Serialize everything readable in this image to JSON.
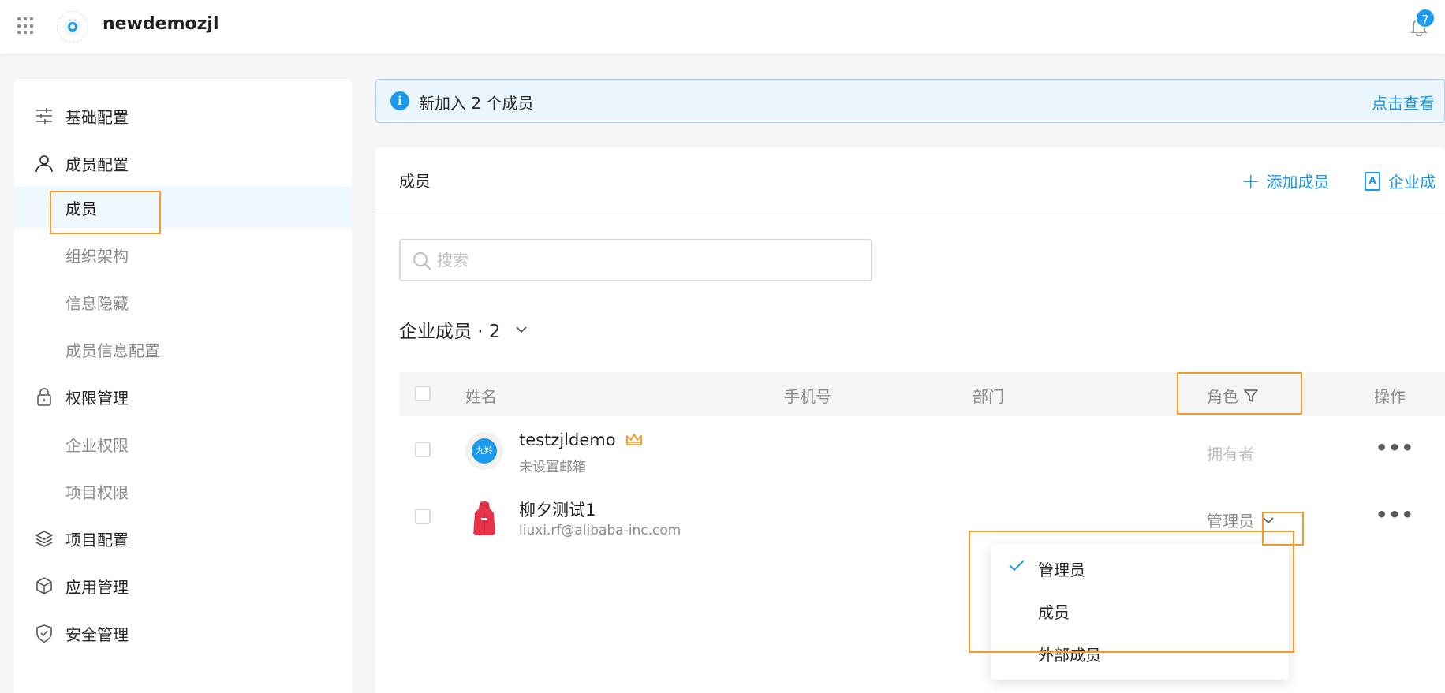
{
  "app": {
    "title": "newdemozjl",
    "notification_count": "7"
  },
  "sidebar": {
    "groups": [
      {
        "label": "基础配置",
        "icon": "sliders-icon"
      },
      {
        "label": "成员配置",
        "icon": "user-icon"
      },
      {
        "label": "权限管理",
        "icon": "lock-icon"
      },
      {
        "label": "项目配置",
        "icon": "layers-icon"
      },
      {
        "label": "应用管理",
        "icon": "cube-icon"
      },
      {
        "label": "安全管理",
        "icon": "shield-icon"
      }
    ],
    "member_sub": [
      "成员",
      "组织架构",
      "信息隐藏",
      "成员信息配置"
    ],
    "permission_sub": [
      "企业权限",
      "项目权限"
    ],
    "active_item": "成员"
  },
  "notice": {
    "text": "新加入 2 个成员",
    "link": "点击查看"
  },
  "panel": {
    "title": "成员",
    "add_member": "添加成员",
    "enterprise_btn": "企业成"
  },
  "search": {
    "placeholder": "搜索"
  },
  "list": {
    "heading": "企业成员 · 2",
    "columns": {
      "name": "姓名",
      "phone": "手机号",
      "department": "部门",
      "role": "角色",
      "actions": "操作"
    },
    "rows": [
      {
        "name": "testzjldemo",
        "email": "未设置邮箱",
        "role": "拥有者",
        "avatar_text": "九羚"
      },
      {
        "name": "柳夕测试1",
        "email": "liuxi.rf@alibaba-inc.com",
        "role": "管理员"
      }
    ],
    "more": "•••"
  },
  "role_dropdown": {
    "options": [
      "管理员",
      "成员",
      "外部成员"
    ],
    "selected": "管理员"
  },
  "colors": {
    "accent": "#1b9aee",
    "highlight": "#f59a23",
    "crown": "#f59a23"
  }
}
